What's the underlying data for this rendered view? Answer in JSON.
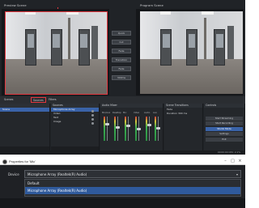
{
  "studio": {
    "preview_label": "Preview Scene",
    "program_label": "Program Scene",
    "transition_buttons": [
      "Quick Transitions",
      "Cut",
      "Fade",
      "Transition",
      "Fade",
      "300ms"
    ],
    "dock_tabs": [
      "Scenes",
      "Sources",
      "Filters",
      "Audio Mixer",
      "Scene Transitions",
      "Controls"
    ],
    "scenes": [
      "Scene"
    ],
    "sources": [
      "Microphone Array",
      "Video",
      "Text",
      "Image"
    ],
    "mixer_labels": [
      "Mic/Aux",
      "Desktop",
      "Mic",
      "Video",
      "Audio",
      "Aux"
    ],
    "transition_fields": [
      "Fade",
      "Duration 300 ms"
    ],
    "controls": [
      "Start Streaming",
      "Start Recording",
      "Studio Mode",
      "Settings",
      "Exit"
    ],
    "status": "00:00:00  CPU: 2.1%"
  },
  "properties": {
    "title": "Properties for 'Mic'",
    "device_label": "Device",
    "device_value": "Microphone Array (Realtek(R) Audio)",
    "options": [
      "Default",
      "Microphone Array (Realtek(R) Audio)"
    ],
    "selected_index": 1
  },
  "colors": {
    "accent_red": "#e2383f",
    "selection_blue": "#3a63a8",
    "panel_bg": "#202327"
  }
}
